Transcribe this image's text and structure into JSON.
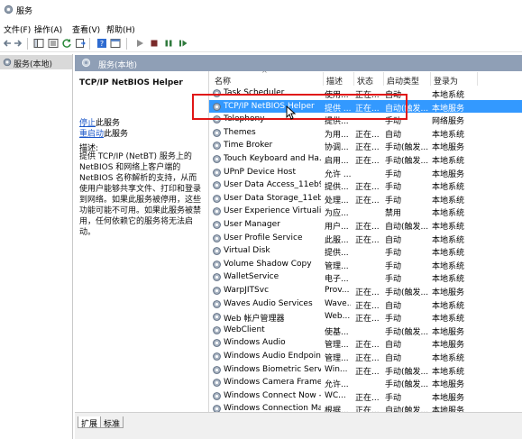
{
  "window": {
    "title": "服务"
  },
  "menu": [
    "文件(F)",
    "操作(A)",
    "查看(V)",
    "帮助(H)"
  ],
  "left_pane": {
    "item_label": "服务(本地)"
  },
  "header": {
    "title": "服务(本地)"
  },
  "details": {
    "service_name": "TCP/IP NetBIOS Helper",
    "stop_link": "停止",
    "stop_suffix": "此服务",
    "restart_link": "重启动",
    "restart_suffix": "此服务",
    "desc_label": "描述:",
    "description": "提供 TCP/IP (NetBT) 服务上的 NetBIOS 和网络上客户端的 NetBIOS 名称解析的支持，从而使用户能够共享文件、打印和登录到网络。如果此服务被停用，这些功能可能不可用。如果此服务被禁用，任何依赖它的服务将无法启动。"
  },
  "columns": {
    "name": "名称",
    "desc": "描述",
    "status": "状态",
    "startup": "启动类型",
    "logon": "登录为"
  },
  "rows": [
    {
      "name": "Task Scheduler",
      "desc": "使用...",
      "status": "正在...",
      "startup": "自动",
      "logon": "本地系统"
    },
    {
      "name": "TCP/IP NetBIOS Helper",
      "desc": "提供 ...",
      "status": "正在...",
      "startup": "自动(触发...",
      "logon": "本地服务",
      "selected": true
    },
    {
      "name": "Telephony",
      "desc": "提供...",
      "status": "",
      "startup": "手动",
      "logon": "网络服务"
    },
    {
      "name": "Themes",
      "desc": "为用...",
      "status": "正在...",
      "startup": "自动",
      "logon": "本地系统"
    },
    {
      "name": "Time Broker",
      "desc": "协调...",
      "status": "正在...",
      "startup": "手动(触发...",
      "logon": "本地服务"
    },
    {
      "name": "Touch Keyboard and Ha...",
      "desc": "启用...",
      "status": "正在...",
      "startup": "手动(触发...",
      "logon": "本地系统"
    },
    {
      "name": "UPnP Device Host",
      "desc": "允许 ...",
      "status": "",
      "startup": "手动",
      "logon": "本地服务"
    },
    {
      "name": "User Data Access_11eb9f...",
      "desc": "提供...",
      "status": "正在...",
      "startup": "手动",
      "logon": "本地系统"
    },
    {
      "name": "User Data Storage_11eb...",
      "desc": "处理...",
      "status": "正在...",
      "startup": "手动",
      "logon": "本地系统"
    },
    {
      "name": "User Experience Virtualiz...",
      "desc": "为应...",
      "status": "",
      "startup": "禁用",
      "logon": "本地系统"
    },
    {
      "name": "User Manager",
      "desc": "用户...",
      "status": "正在...",
      "startup": "自动(触发...",
      "logon": "本地系统"
    },
    {
      "name": "User Profile Service",
      "desc": "此服...",
      "status": "正在...",
      "startup": "自动",
      "logon": "本地系统"
    },
    {
      "name": "Virtual Disk",
      "desc": "提供...",
      "status": "",
      "startup": "手动",
      "logon": "本地系统"
    },
    {
      "name": "Volume Shadow Copy",
      "desc": "管理...",
      "status": "",
      "startup": "手动",
      "logon": "本地系统"
    },
    {
      "name": "WalletService",
      "desc": "电子...",
      "status": "",
      "startup": "手动",
      "logon": "本地系统"
    },
    {
      "name": "WarpJITSvc",
      "desc": "Prov...",
      "status": "正在...",
      "startup": "手动(触发...",
      "logon": "本地服务"
    },
    {
      "name": "Waves Audio Services",
      "desc": "Wave...",
      "status": "正在...",
      "startup": "自动",
      "logon": "本地系统"
    },
    {
      "name": "Web 帐户管理器",
      "desc": "Web...",
      "status": "正在...",
      "startup": "手动",
      "logon": "本地系统"
    },
    {
      "name": "WebClient",
      "desc": "使基...",
      "status": "",
      "startup": "手动(触发...",
      "logon": "本地服务"
    },
    {
      "name": "Windows Audio",
      "desc": "管理...",
      "status": "正在...",
      "startup": "自动",
      "logon": "本地服务"
    },
    {
      "name": "Windows Audio Endpoint...",
      "desc": "管理...",
      "status": "正在...",
      "startup": "自动",
      "logon": "本地系统"
    },
    {
      "name": "Windows Biometric Servi...",
      "desc": "Win...",
      "status": "正在...",
      "startup": "手动(触发...",
      "logon": "本地系统"
    },
    {
      "name": "Windows Camera Frame ...",
      "desc": "允许...",
      "status": "",
      "startup": "手动(触发...",
      "logon": "本地服务"
    },
    {
      "name": "Windows Connect Now -...",
      "desc": "WC...",
      "status": "正在...",
      "startup": "手动",
      "logon": "本地服务"
    },
    {
      "name": "Windows Connection Ma...",
      "desc": "根据...",
      "status": "正在...",
      "startup": "自动(触发...",
      "logon": "本地服务"
    }
  ],
  "tabs": [
    "扩展",
    "标准"
  ],
  "colors": {
    "header_band": "#8f9fb6",
    "selection": "#3399ff",
    "highlight_box": "#e01616",
    "link": "#1a56c8"
  }
}
